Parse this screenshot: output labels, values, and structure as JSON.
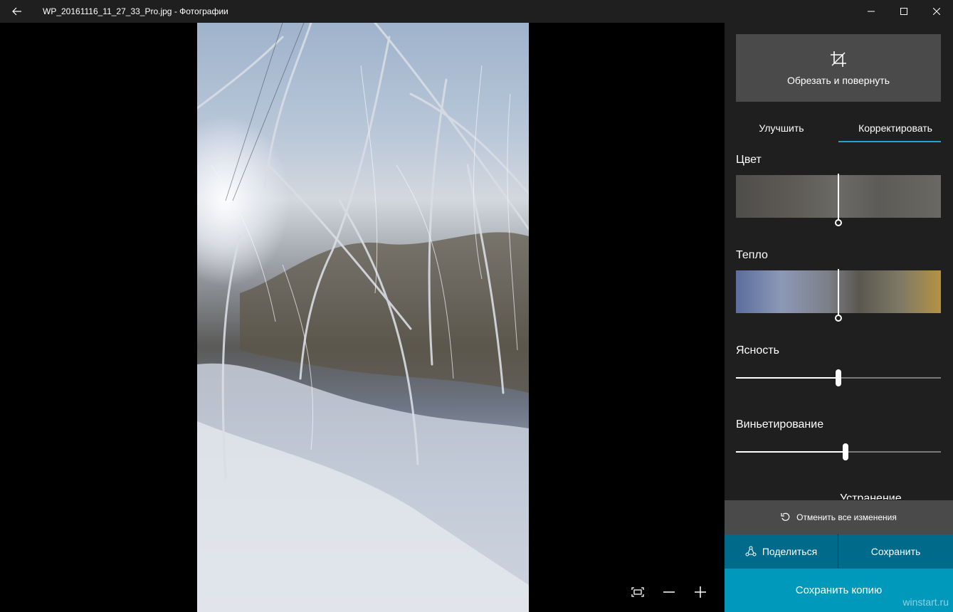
{
  "window": {
    "title": "WP_20161116_11_27_33_Pro.jpg - Фотографии"
  },
  "panel": {
    "crop_label": "Обрезать и повернуть",
    "tabs": [
      {
        "label": "Улучшить",
        "active": false
      },
      {
        "label": "Корректировать",
        "active": true
      }
    ],
    "sections": {
      "color": {
        "label": "Цвет",
        "value": 0.5
      },
      "warmth": {
        "label": "Тепло",
        "value": 0.5
      },
      "clarity": {
        "label": "Ясность",
        "value": 0.5
      },
      "vignette": {
        "label": "Виньетирование",
        "value": 0.535
      }
    },
    "next_section_partial": "Устранение",
    "revert_label": "Отменить все изменения",
    "share_label": "Поделиться",
    "save_label": "Сохранить",
    "save_copy_label": "Сохранить копию"
  },
  "watermark": "winstart.ru",
  "icons": {
    "back": "back-arrow-icon",
    "minimize": "minimize-icon",
    "maximize": "maximize-icon",
    "close": "close-icon",
    "crop": "crop-icon",
    "fit": "fit-to-screen-icon",
    "zoom_out": "zoom-out-icon",
    "zoom_in": "zoom-in-icon",
    "undo": "undo-icon",
    "share": "share-icon"
  },
  "colors": {
    "accent": "#0099bc",
    "accent_dark": "#006a8a",
    "tab_underline": "#2a9fd6",
    "panel_bg": "#1f1f1f"
  }
}
